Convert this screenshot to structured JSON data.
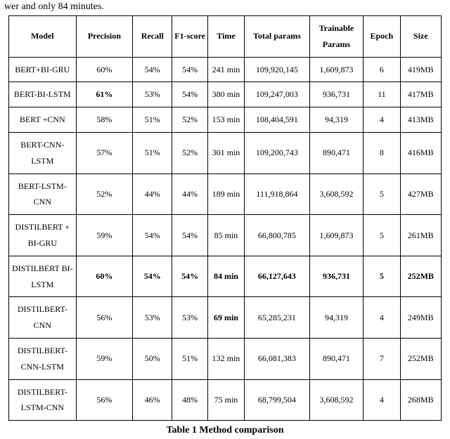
{
  "pretext": "wer and only 84 minutes.",
  "caption": "Table 1 Method comparison",
  "headers": [
    "Model",
    "Precision",
    "Recall",
    "F1-score",
    "Time",
    "Total params",
    "Trainable Params",
    "Epoch",
    "Size"
  ],
  "rows": [
    {
      "model": "BERT+BI-GRU",
      "precision": "60%",
      "recall": "54%",
      "f1": "54%",
      "time": "241 min",
      "total": "109,920,145",
      "train": "1,609,873",
      "epoch": "6",
      "size": "419MB",
      "bold": []
    },
    {
      "model": "BERT-BI-LSTM",
      "precision": "61%",
      "recall": "53%",
      "f1": "54%",
      "time": "380 min",
      "total": "109,247,003",
      "train": "936,731",
      "epoch": "11",
      "size": "417MB",
      "bold": [
        "precision"
      ]
    },
    {
      "model": "BERT +CNN",
      "precision": "58%",
      "recall": "51%",
      "f1": "52%",
      "time": "153 min",
      "total": "108,404,591",
      "train": "94,319",
      "epoch": "4",
      "size": "413MB",
      "bold": []
    },
    {
      "model": "BERT-CNN-LSTM",
      "precision": "57%",
      "recall": "51%",
      "f1": "52%",
      "time": "301 min",
      "total": "109,200,743",
      "train": "890,471",
      "epoch": "8",
      "size": "416MB",
      "bold": []
    },
    {
      "model": "BERT-LSTM-CNN",
      "precision": "52%",
      "recall": "44%",
      "f1": "44%",
      "time": "189 min",
      "total": "111,918,864",
      "train": "3,608,592",
      "epoch": "5",
      "size": "427MB",
      "bold": []
    },
    {
      "model": "DISTILBERT + BI-GRU",
      "precision": "59%",
      "recall": "54%",
      "f1": "54%",
      "time": "85 min",
      "total": "66,800,785",
      "train": "1,609,873",
      "epoch": "5",
      "size": "261MB",
      "bold": []
    },
    {
      "model": "DISTILBERT BI-LSTM",
      "precision": "60%",
      "recall": "54%",
      "f1": "54%",
      "time": "84 min",
      "total": "66,127,643",
      "train": "936,731",
      "epoch": "5",
      "size": "252MB",
      "bold": [
        "precision",
        "recall",
        "f1",
        "time",
        "total",
        "train",
        "epoch",
        "size"
      ]
    },
    {
      "model": "DISTILBERT-CNN",
      "precision": "56%",
      "recall": "53%",
      "f1": "53%",
      "time": "69 min",
      "total": "65,285,231",
      "train": "94,319",
      "epoch": "4",
      "size": "249MB",
      "bold": [
        "time"
      ]
    },
    {
      "model": "DISTILBERT-CNN-LSTM",
      "precision": "59%",
      "recall": "50%",
      "f1": "51%",
      "time": "132 min",
      "total": "66,081,383",
      "train": "890,471",
      "epoch": "7",
      "size": "252MB",
      "bold": []
    },
    {
      "model": "DISTILBERT-LSTM-CNN",
      "precision": "56%",
      "recall": "46%",
      "f1": "48%",
      "time": "75 min",
      "total": "68,799,504",
      "train": "3,608,592",
      "epoch": "4",
      "size": "268MB",
      "bold": []
    }
  ],
  "chart_data": {
    "type": "table",
    "title": "Table 1 Method comparison",
    "columns": [
      "Model",
      "Precision",
      "Recall",
      "F1-score",
      "Time",
      "Total params",
      "Trainable Params",
      "Epoch",
      "Size"
    ],
    "rows": [
      [
        "BERT+BI-GRU",
        "60%",
        "54%",
        "54%",
        "241 min",
        "109,920,145",
        "1,609,873",
        "6",
        "419MB"
      ],
      [
        "BERT-BI-LSTM",
        "61%",
        "53%",
        "54%",
        "380 min",
        "109,247,003",
        "936,731",
        "11",
        "417MB"
      ],
      [
        "BERT +CNN",
        "58%",
        "51%",
        "52%",
        "153 min",
        "108,404,591",
        "94,319",
        "4",
        "413MB"
      ],
      [
        "BERT-CNN-LSTM",
        "57%",
        "51%",
        "52%",
        "301 min",
        "109,200,743",
        "890,471",
        "8",
        "416MB"
      ],
      [
        "BERT-LSTM-CNN",
        "52%",
        "44%",
        "44%",
        "189 min",
        "111,918,864",
        "3,608,592",
        "5",
        "427MB"
      ],
      [
        "DISTILBERT + BI-GRU",
        "59%",
        "54%",
        "54%",
        "85 min",
        "66,800,785",
        "1,609,873",
        "5",
        "261MB"
      ],
      [
        "DISTILBERT BI-LSTM",
        "60%",
        "54%",
        "54%",
        "84 min",
        "66,127,643",
        "936,731",
        "5",
        "252MB"
      ],
      [
        "DISTILBERT-CNN",
        "56%",
        "53%",
        "53%",
        "69 min",
        "65,285,231",
        "94,319",
        "4",
        "249MB"
      ],
      [
        "DISTILBERT-CNN-LSTM",
        "59%",
        "50%",
        "51%",
        "132 min",
        "66,081,383",
        "890,471",
        "7",
        "252MB"
      ],
      [
        "DISTILBERT-LSTM-CNN",
        "56%",
        "46%",
        "48%",
        "75 min",
        "68,799,504",
        "3,608,592",
        "4",
        "268MB"
      ]
    ]
  }
}
